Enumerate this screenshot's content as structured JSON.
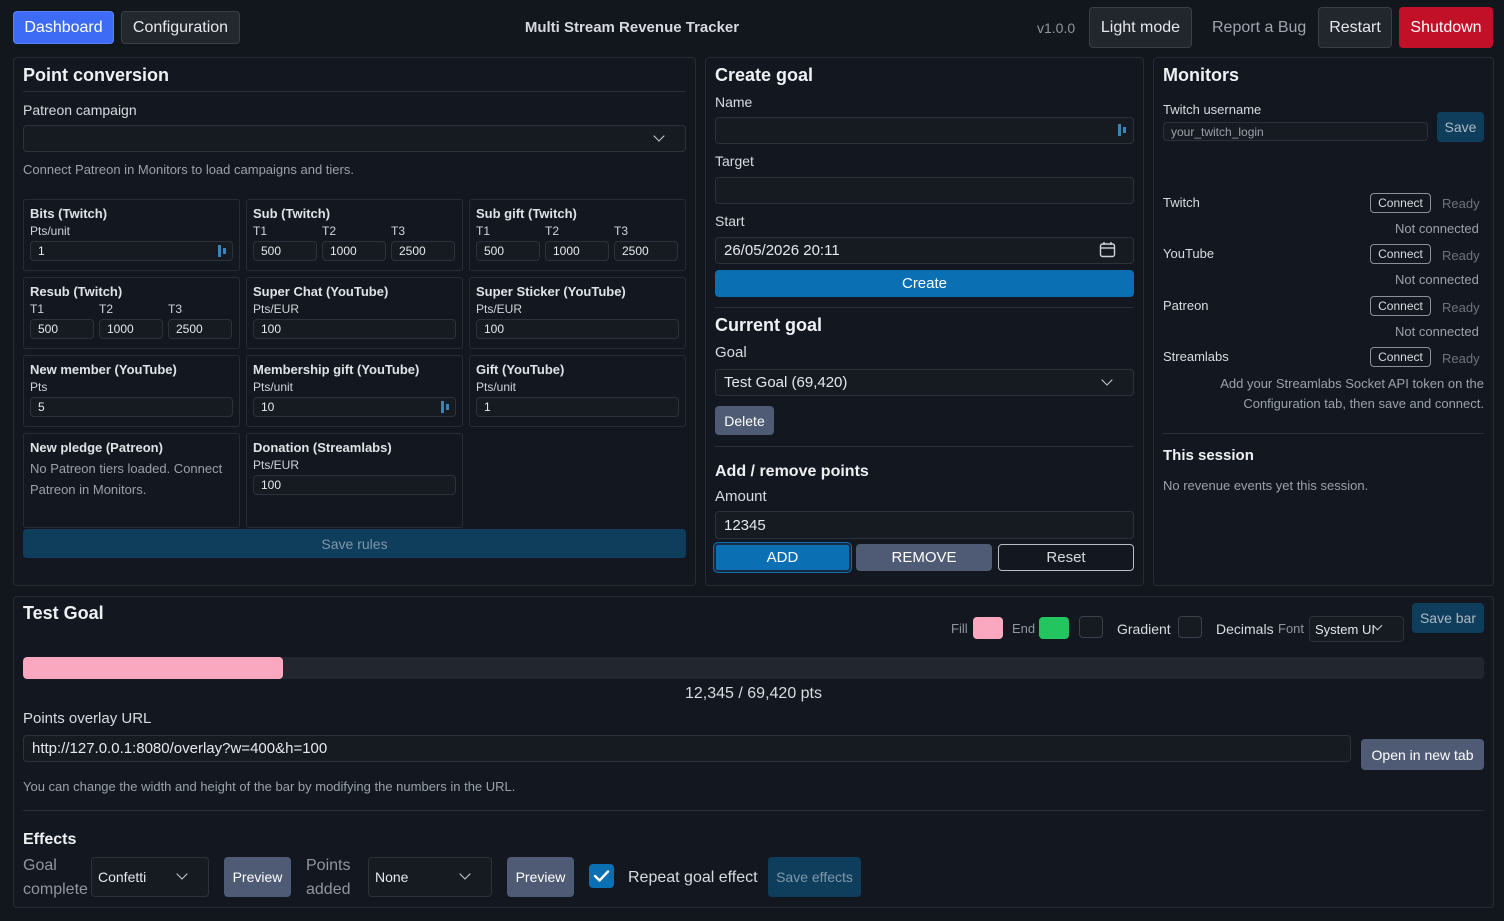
{
  "header": {
    "tab_dashboard": "Dashboard",
    "tab_configuration": "Configuration",
    "title": "Multi Stream Revenue Tracker",
    "version": "v1.0.0",
    "light_mode": "Light mode",
    "report_bug": "Report a Bug",
    "restart": "Restart",
    "shutdown": "Shutdown"
  },
  "point_conversion": {
    "title": "Point conversion",
    "patreon_label": "Patreon campaign",
    "patreon_value": "",
    "patreon_hint": "Connect Patreon in Monitors to load campaigns and tiers.",
    "bits": {
      "title": "Bits (Twitch)",
      "unit": "Pts/unit",
      "value": "1"
    },
    "sub": {
      "title": "Sub (Twitch)",
      "t1": "T1",
      "t2": "T2",
      "t3": "T3",
      "v1": "500",
      "v2": "1000",
      "v3": "2500"
    },
    "subgift": {
      "title": "Sub gift (Twitch)",
      "t1": "T1",
      "t2": "T2",
      "t3": "T3",
      "v1": "500",
      "v2": "1000",
      "v3": "2500"
    },
    "resub": {
      "title": "Resub (Twitch)",
      "t1": "T1",
      "t2": "T2",
      "t3": "T3",
      "v1": "500",
      "v2": "1000",
      "v3": "2500"
    },
    "superchat": {
      "title": "Super Chat (YouTube)",
      "unit": "Pts/EUR",
      "value": "100"
    },
    "supersticker": {
      "title": "Super Sticker (YouTube)",
      "unit": "Pts/EUR",
      "value": "100"
    },
    "newmember": {
      "title": "New member (YouTube)",
      "unit": "Pts",
      "value": "5"
    },
    "membershipgift": {
      "title": "Membership gift (YouTube)",
      "unit": "Pts/unit",
      "value": "10"
    },
    "gift": {
      "title": "Gift (YouTube)",
      "unit": "Pts/unit",
      "value": "1"
    },
    "newpledge": {
      "title": "New pledge (Patreon)",
      "note_line1": "No Patreon tiers loaded. Connect",
      "note_line2": "Patreon in Monitors."
    },
    "donation": {
      "title": "Donation (Streamlabs)",
      "unit": "Pts/EUR",
      "value": "100"
    },
    "save_rules": "Save rules"
  },
  "create_goal": {
    "title": "Create goal",
    "name_label": "Name",
    "name_value": "",
    "target_label": "Target",
    "target_value": "",
    "start_label": "Start",
    "start_value": "26/05/2026  20:11",
    "create_button": "Create"
  },
  "current_goal": {
    "title": "Current goal",
    "goal_label": "Goal",
    "goal_value": "Test Goal (69,420)",
    "delete_button": "Delete"
  },
  "add_remove": {
    "title": "Add / remove points",
    "amount_label": "Amount",
    "amount_value": "12345",
    "add": "ADD",
    "remove": "REMOVE",
    "reset": "Reset"
  },
  "monitors": {
    "title": "Monitors",
    "username_label": "Twitch username",
    "username_placeholder": "your_twitch_login",
    "save": "Save",
    "connect": "Connect",
    "ready": "Ready",
    "not_connected": "Not connected",
    "services": [
      "Twitch",
      "YouTube",
      "Patreon",
      "Streamlabs"
    ],
    "streamlabs_hint_line1": "Add your Streamlabs Socket API token on the",
    "streamlabs_hint_line2": "Configuration tab, then save and connect.",
    "session_title": "This session",
    "session_text": "No revenue events yet this session."
  },
  "goal_bar": {
    "title": "Test Goal",
    "fill_label": "Fill",
    "end_label": "End",
    "gradient_label": "Gradient",
    "decimals_label": "Decimals",
    "font_label": "Font",
    "font_value": "System UI",
    "save_bar": "Save bar",
    "fill_color": "#f9a8c0",
    "end_color": "#22c55e",
    "progress_fraction": 0.1778,
    "progress_text": "12,345 / 69,420 pts",
    "overlay_label": "Points overlay URL",
    "overlay_url": "http://127.0.0.1:8080/overlay?w=400&h=100",
    "open_tab": "Open in new tab",
    "overlay_hint": "You can change the width and height of the bar by modifying the numbers in the URL."
  },
  "effects": {
    "title": "Effects",
    "goal_complete_line1": "Goal",
    "goal_complete_line2": "complete",
    "goal_effect": "Confetti",
    "preview": "Preview",
    "points_added_line1": "Points",
    "points_added_line2": "added",
    "points_effect": "None",
    "repeat_label": "Repeat goal effect",
    "save_effects": "Save effects"
  },
  "colors": {
    "primary": "#3d6bf5",
    "create_blue": "#0b6fb3",
    "shutdown_red": "#c11027",
    "save_dark_blue": "#0f3e5c"
  }
}
